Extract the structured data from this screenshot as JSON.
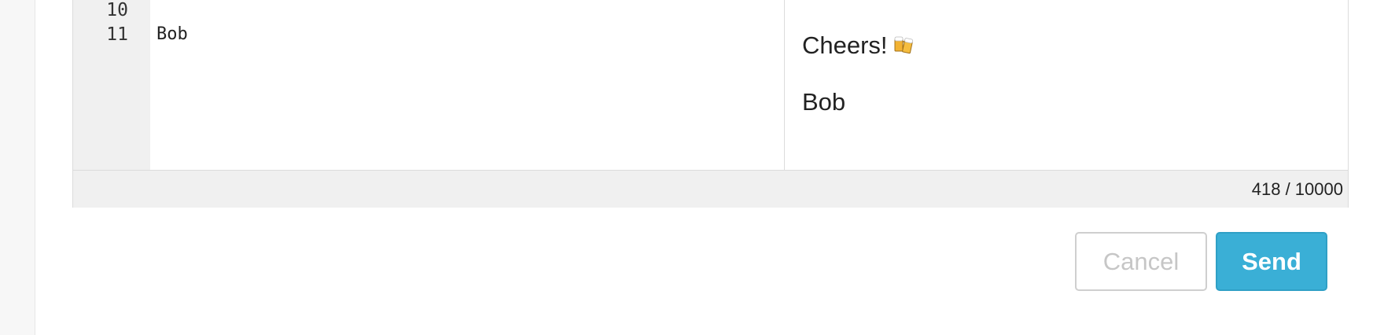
{
  "editor": {
    "line_numbers": [
      "10",
      "11"
    ],
    "code_lines": [
      "",
      "Bob"
    ]
  },
  "preview": {
    "closing": "Cheers!",
    "closing_icon": "beer-mugs-icon",
    "signature": "Bob"
  },
  "status": {
    "char_count": "418 / 10000"
  },
  "actions": {
    "cancel_label": "Cancel",
    "send_label": "Send"
  },
  "colors": {
    "send_button": "#3aafd6",
    "gutter": "#f0f0f0",
    "cancel_text": "#c6c6c6"
  }
}
